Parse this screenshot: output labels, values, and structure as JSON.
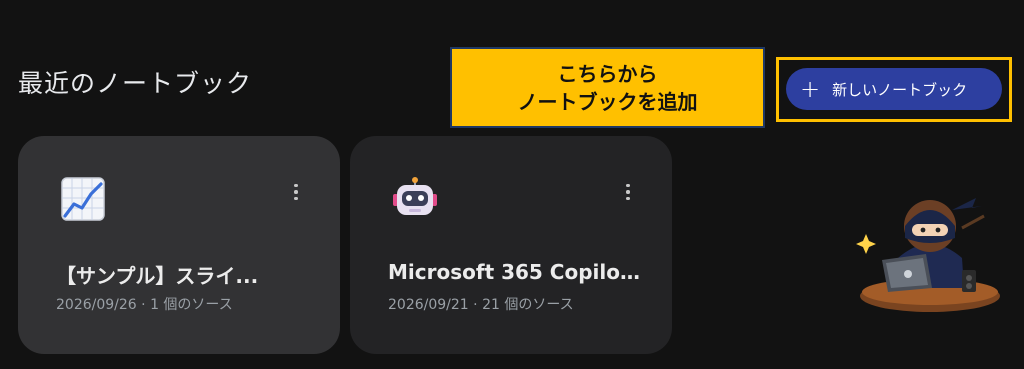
{
  "section": {
    "title": "最近のノートブック"
  },
  "callout": {
    "line1": "こちらから",
    "line2": "ノートブックを追加"
  },
  "new_button": {
    "icon": "plus-icon",
    "label": "新しいノートブック"
  },
  "notebooks": [
    {
      "icon": "chart-increasing-icon",
      "title": "【サンプル】スライ...",
      "date": "2026/09/26",
      "sources": "1 個のソース"
    },
    {
      "icon": "robot-icon",
      "title": "Microsoft 365 Copilot...",
      "date": "2026/09/21",
      "sources": "21 個のソース"
    }
  ],
  "colors": {
    "accent_button": "#2d3fa0",
    "callout_bg": "#ffc000",
    "background": "#121212"
  }
}
